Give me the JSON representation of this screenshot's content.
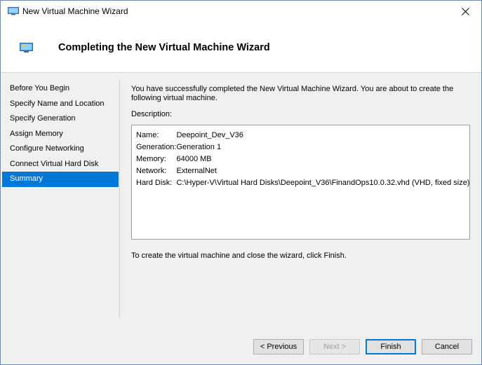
{
  "window": {
    "title": "New Virtual Machine Wizard",
    "close_glyph": "✕"
  },
  "header": {
    "title": "Completing the New Virtual Machine Wizard"
  },
  "sidebar": {
    "items": [
      {
        "label": "Before You Begin",
        "active": false
      },
      {
        "label": "Specify Name and Location",
        "active": false
      },
      {
        "label": "Specify Generation",
        "active": false
      },
      {
        "label": "Assign Memory",
        "active": false
      },
      {
        "label": "Configure Networking",
        "active": false
      },
      {
        "label": "Connect Virtual Hard Disk",
        "active": false
      },
      {
        "label": "Summary",
        "active": true
      }
    ]
  },
  "content": {
    "intro": "You have successfully completed the New Virtual Machine Wizard. You are about to create the following virtual machine.",
    "description_label": "Description:",
    "description": {
      "rows": [
        {
          "key": "Name:",
          "value": "Deepoint_Dev_V36"
        },
        {
          "key": "Generation:",
          "value": "Generation 1"
        },
        {
          "key": "Memory:",
          "value": "64000 MB"
        },
        {
          "key": "Network:",
          "value": "ExternalNet"
        },
        {
          "key": "Hard Disk:",
          "value": "C:\\Hyper-V\\Virtual Hard Disks\\Deepoint_V36\\FinandOps10.0.32.vhd (VHD, fixed size)"
        }
      ]
    },
    "finish_note": "To create the virtual machine and close the wizard, click Finish."
  },
  "buttons": {
    "previous": "< Previous",
    "next": "Next >",
    "finish": "Finish",
    "cancel": "Cancel"
  },
  "colors": {
    "accent": "#0078d7",
    "window_border": "#6e8ab3"
  },
  "icons": {
    "title": "monitor-icon",
    "header": "monitor-icon",
    "close": "close-icon"
  }
}
